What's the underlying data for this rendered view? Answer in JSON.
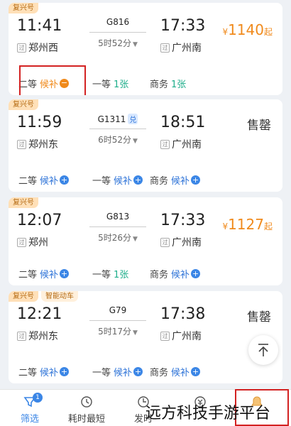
{
  "trains": [
    {
      "tags": [
        "复兴号"
      ],
      "dep_time": "11:41",
      "dep_station": "郑州西",
      "train_no": "G816",
      "dui": "",
      "duration": "5时52分",
      "arr_time": "17:33",
      "arr_station": "广州南",
      "price_currency": "¥",
      "price_amount": "1140",
      "price_suffix": "起",
      "sold_out": "",
      "seats": [
        {
          "name": "二等",
          "status": "候补",
          "kind": "waitlist-warn"
        },
        {
          "name": "一等",
          "status": "1张",
          "kind": "count"
        },
        {
          "name": "商务",
          "status": "1张",
          "kind": "count"
        }
      ]
    },
    {
      "tags": [
        "复兴号"
      ],
      "dep_time": "11:59",
      "dep_station": "郑州东",
      "train_no": "G1311",
      "dui": "兑",
      "duration": "6时52分",
      "arr_time": "18:51",
      "arr_station": "广州南",
      "price_currency": "",
      "price_amount": "",
      "price_suffix": "",
      "sold_out": "售罄",
      "seats": [
        {
          "name": "二等",
          "status": "候补",
          "kind": "waitlist"
        },
        {
          "name": "一等",
          "status": "候补",
          "kind": "waitlist"
        },
        {
          "name": "商务",
          "status": "候补",
          "kind": "waitlist"
        }
      ]
    },
    {
      "tags": [
        "复兴号"
      ],
      "dep_time": "12:07",
      "dep_station": "郑州",
      "train_no": "G813",
      "dui": "",
      "duration": "5时26分",
      "arr_time": "17:33",
      "arr_station": "广州南",
      "price_currency": "¥",
      "price_amount": "1127",
      "price_suffix": "起",
      "sold_out": "",
      "seats": [
        {
          "name": "二等",
          "status": "候补",
          "kind": "waitlist"
        },
        {
          "name": "一等",
          "status": "1张",
          "kind": "count"
        },
        {
          "name": "商务",
          "status": "候补",
          "kind": "waitlist"
        }
      ]
    },
    {
      "tags": [
        "复兴号",
        "智能动车"
      ],
      "dep_time": "12:21",
      "dep_station": "郑州东",
      "train_no": "G79",
      "dui": "",
      "duration": "5时17分",
      "arr_time": "17:38",
      "arr_station": "广州南",
      "price_currency": "",
      "price_amount": "",
      "price_suffix": "",
      "sold_out": "售罄",
      "seats": [
        {
          "name": "二等",
          "status": "候补",
          "kind": "waitlist"
        },
        {
          "name": "一等",
          "status": "候补",
          "kind": "waitlist"
        },
        {
          "name": "商务",
          "status": "候补",
          "kind": "waitlist"
        }
      ]
    }
  ],
  "station_badge": "过",
  "bottom_bar": [
    {
      "label": "筛选",
      "icon": "filter-icon",
      "badge": "1",
      "active": true
    },
    {
      "label": "耗时最短",
      "icon": "clock-icon",
      "badge": "",
      "active": false
    },
    {
      "label": "发时",
      "icon": "depart-icon",
      "badge": "",
      "active": false
    },
    {
      "label": "",
      "icon": "price-icon",
      "badge": "",
      "active": false
    },
    {
      "label": "",
      "icon": "waitlist-icon",
      "badge": "",
      "active": false
    }
  ],
  "watermark": "远方科技手游平台",
  "colors": {
    "accent": "#3b86e6",
    "price": "#f08a1c",
    "available": "#1fae8b",
    "highlight": "#d32222"
  }
}
